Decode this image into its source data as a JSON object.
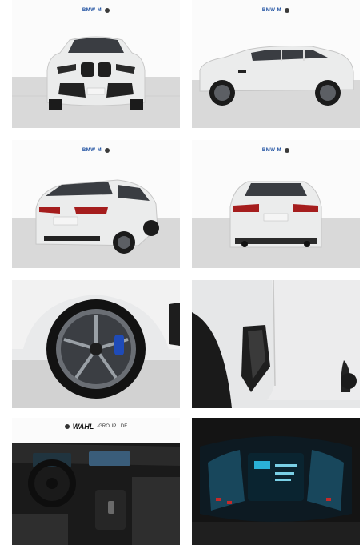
{
  "gallery": {
    "tiles": [
      {
        "name": "front-view",
        "alt": ""
      },
      {
        "name": "side-view",
        "alt": ""
      },
      {
        "name": "rear-three-quarter-view",
        "alt": ""
      },
      {
        "name": "rear-view",
        "alt": ""
      },
      {
        "name": "wheel-detail",
        "alt": ""
      },
      {
        "name": "side-vent-detail",
        "alt": ""
      },
      {
        "name": "interior-cockpit",
        "alt": ""
      },
      {
        "name": "instrument-cluster",
        "alt": ""
      }
    ],
    "showroom_logos": "BMW  M",
    "dealer_brand": "WAHL",
    "dealer_suffix": "-GROUP",
    "dealer_tld": ".DE"
  },
  "colors": {
    "car_body": "#e9eaeb",
    "wall": "#ffffff",
    "floor": "#d7d7d7",
    "tire": "#1b1b1b",
    "grille": "#1f1f1f",
    "light_red": "#a51d1d",
    "caliper_blue": "#1f4bb8",
    "cluster_blue": "#2ab0d6",
    "interior": "#1a1a1a"
  }
}
